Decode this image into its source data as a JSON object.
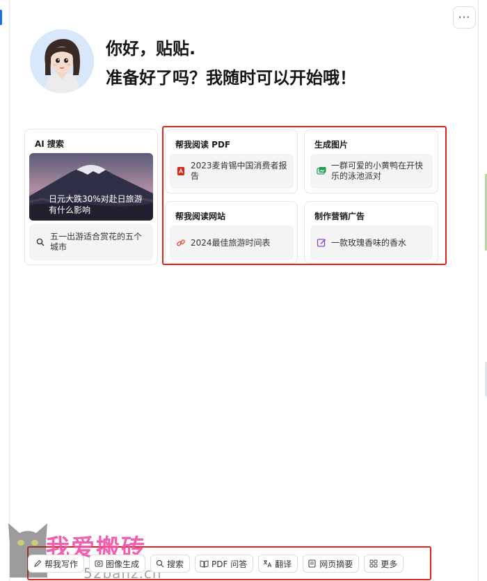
{
  "header": {
    "more_label": "···"
  },
  "greeting": {
    "line1": "你好，贴贴.",
    "line2": "准备好了吗？我随时可以开始哦！"
  },
  "cards": {
    "ai_search": {
      "title": "AI 搜索",
      "image_caption": "日元大跌30%对赴日旅游有什么影响",
      "item": "五一出游适合赏花的五个城市"
    },
    "read_pdf": {
      "title": "帮我阅读 PDF",
      "item": "2023麦肯锡中国消费者报告"
    },
    "gen_image": {
      "title": "生成图片",
      "item": "一群可爱的小黄鸭在开快乐的泳池派对"
    },
    "read_web": {
      "title": "帮我阅读网站",
      "item": "2024最佳旅游时间表"
    },
    "marketing": {
      "title": "制作营销广告",
      "item": "一款玫瑰香味的香水"
    }
  },
  "toolbar": {
    "items": [
      {
        "label": "帮我写作",
        "icon": "pen-icon"
      },
      {
        "label": "图像生成",
        "icon": "image-icon"
      },
      {
        "label": "搜索",
        "icon": "search-icon"
      },
      {
        "label": "PDF 问答",
        "icon": "book-icon"
      },
      {
        "label": "翻译",
        "icon": "translate-icon"
      },
      {
        "label": "网页摘要",
        "icon": "webpage-icon"
      },
      {
        "label": "更多",
        "icon": "grid-icon"
      }
    ]
  },
  "watermark": {
    "text": "我爱搬砖",
    "url": "52banz.cn"
  },
  "colors": {
    "accent": "#1d6fe8",
    "highlight_box": "#e3211b",
    "watermark": "#f04fa8"
  }
}
